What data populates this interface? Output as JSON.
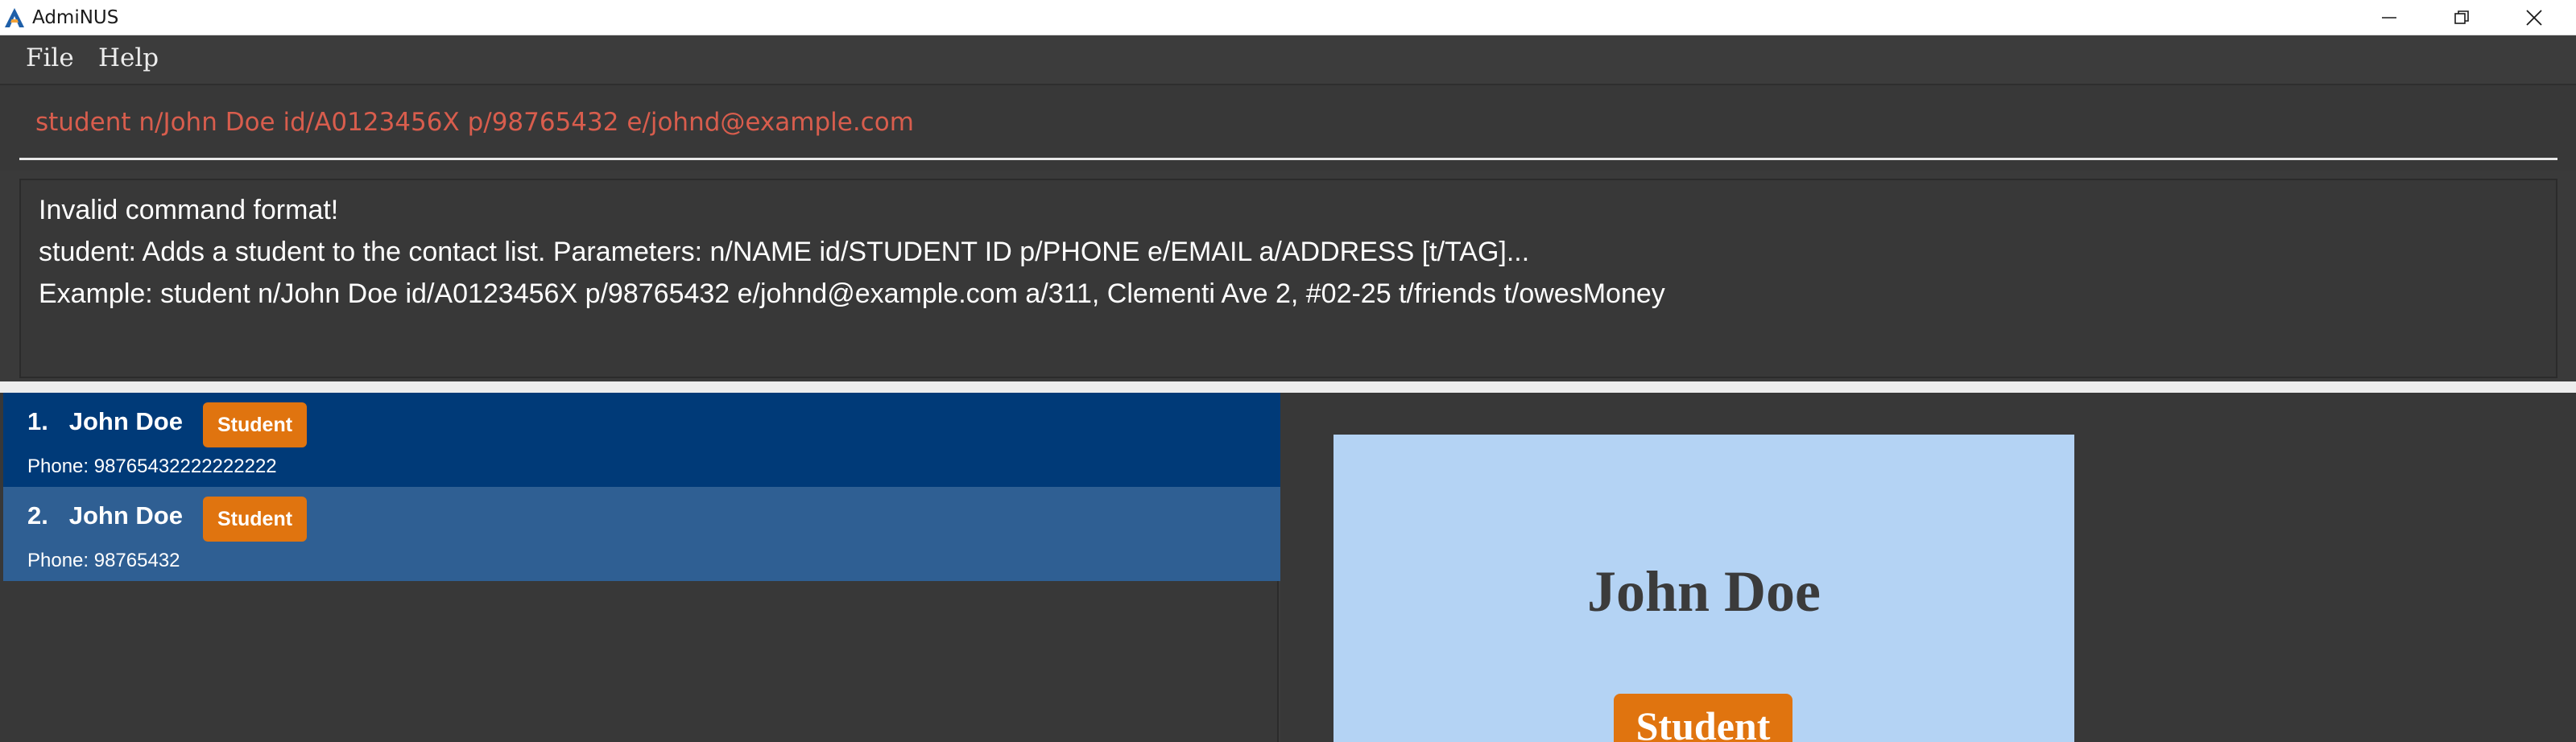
{
  "window": {
    "title": "AdmiNUS"
  },
  "menu": {
    "items": [
      "File",
      "Help"
    ]
  },
  "command_box": {
    "value": "student n/John Doe id/A0123456X p/98765432 e/johnd@example.com",
    "text_color": "#d85d4d"
  },
  "result_display": {
    "lines": [
      "Invalid command format!",
      "student: Adds a student to the contact list. Parameters: n/NAME id/STUDENT ID p/PHONE e/EMAIL a/ADDRESS [t/TAG]...",
      "Example: student n/John Doe id/A0123456X p/98765432 e/johnd@example.com a/311, Clementi Ave 2, #02-25 t/friends t/owesMoney"
    ]
  },
  "person_list": {
    "items": [
      {
        "index": "1.",
        "name": "John Doe",
        "tag": "Student",
        "phone": "Phone: 98765432222222222",
        "selected": true
      },
      {
        "index": "2.",
        "name": "John Doe",
        "tag": "Student",
        "phone": "Phone: 98765432",
        "selected": false
      }
    ],
    "selected_color": "#003a78",
    "row_color": "#2f5f93"
  },
  "detail_card": {
    "name": "John Doe",
    "tag": "Student",
    "background": "#b4d3f4"
  },
  "colors": {
    "tag": "#e0740f",
    "app_background": "#3c3c3c"
  },
  "icons": {
    "logo": "adminus-logo-icon",
    "minimize": "minimize-icon",
    "restore": "restore-icon",
    "close": "close-icon"
  }
}
